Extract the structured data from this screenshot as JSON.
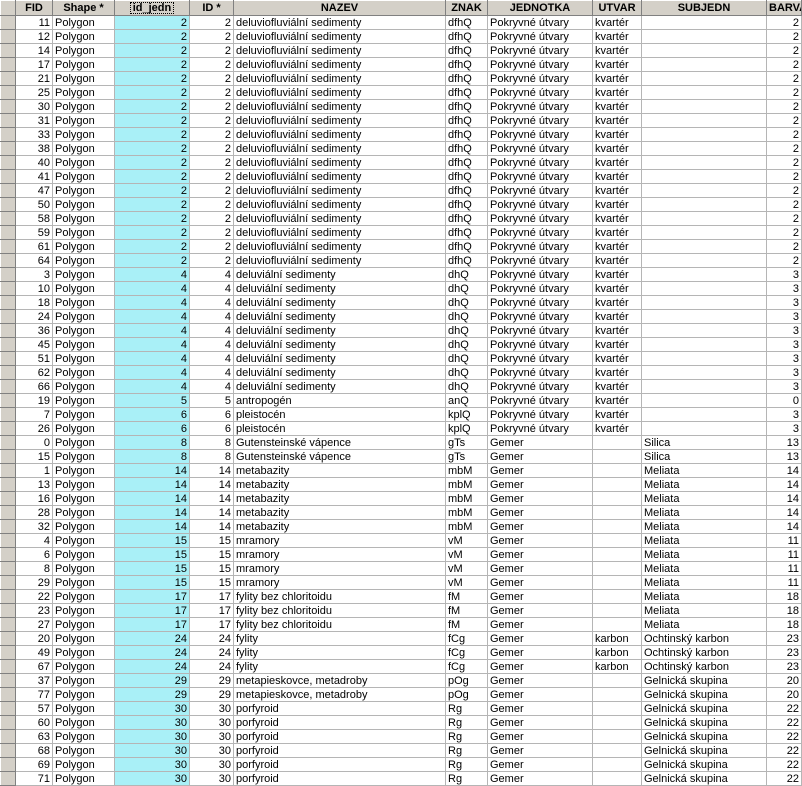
{
  "columns": [
    "",
    "FID",
    "Shape *",
    "id_jedn",
    "ID *",
    "NAZEV",
    "ZNAK",
    "JEDNOTKA",
    "UTVAR",
    "SUBJEDN",
    "BARVA"
  ],
  "rows": [
    [
      "11",
      "Polygon",
      "2",
      "2",
      "deluviofluviální sedimenty",
      "dfhQ",
      "Pokryvné útvary",
      "kvartér",
      "",
      "2"
    ],
    [
      "12",
      "Polygon",
      "2",
      "2",
      "deluviofluviální sedimenty",
      "dfhQ",
      "Pokryvné útvary",
      "kvartér",
      "",
      "2"
    ],
    [
      "14",
      "Polygon",
      "2",
      "2",
      "deluviofluviální sedimenty",
      "dfhQ",
      "Pokryvné útvary",
      "kvartér",
      "",
      "2"
    ],
    [
      "17",
      "Polygon",
      "2",
      "2",
      "deluviofluviální sedimenty",
      "dfhQ",
      "Pokryvné útvary",
      "kvartér",
      "",
      "2"
    ],
    [
      "21",
      "Polygon",
      "2",
      "2",
      "deluviofluviální sedimenty",
      "dfhQ",
      "Pokryvné útvary",
      "kvartér",
      "",
      "2"
    ],
    [
      "25",
      "Polygon",
      "2",
      "2",
      "deluviofluviální sedimenty",
      "dfhQ",
      "Pokryvné útvary",
      "kvartér",
      "",
      "2"
    ],
    [
      "30",
      "Polygon",
      "2",
      "2",
      "deluviofluviální sedimenty",
      "dfhQ",
      "Pokryvné útvary",
      "kvartér",
      "",
      "2"
    ],
    [
      "31",
      "Polygon",
      "2",
      "2",
      "deluviofluviální sedimenty",
      "dfhQ",
      "Pokryvné útvary",
      "kvartér",
      "",
      "2"
    ],
    [
      "33",
      "Polygon",
      "2",
      "2",
      "deluviofluviální sedimenty",
      "dfhQ",
      "Pokryvné útvary",
      "kvartér",
      "",
      "2"
    ],
    [
      "38",
      "Polygon",
      "2",
      "2",
      "deluviofluviální sedimenty",
      "dfhQ",
      "Pokryvné útvary",
      "kvartér",
      "",
      "2"
    ],
    [
      "40",
      "Polygon",
      "2",
      "2",
      "deluviofluviální sedimenty",
      "dfhQ",
      "Pokryvné útvary",
      "kvartér",
      "",
      "2"
    ],
    [
      "41",
      "Polygon",
      "2",
      "2",
      "deluviofluviální sedimenty",
      "dfhQ",
      "Pokryvné útvary",
      "kvartér",
      "",
      "2"
    ],
    [
      "47",
      "Polygon",
      "2",
      "2",
      "deluviofluviální sedimenty",
      "dfhQ",
      "Pokryvné útvary",
      "kvartér",
      "",
      "2"
    ],
    [
      "50",
      "Polygon",
      "2",
      "2",
      "deluviofluviální sedimenty",
      "dfhQ",
      "Pokryvné útvary",
      "kvartér",
      "",
      "2"
    ],
    [
      "58",
      "Polygon",
      "2",
      "2",
      "deluviofluviální sedimenty",
      "dfhQ",
      "Pokryvné útvary",
      "kvartér",
      "",
      "2"
    ],
    [
      "59",
      "Polygon",
      "2",
      "2",
      "deluviofluviální sedimenty",
      "dfhQ",
      "Pokryvné útvary",
      "kvartér",
      "",
      "2"
    ],
    [
      "61",
      "Polygon",
      "2",
      "2",
      "deluviofluviální sedimenty",
      "dfhQ",
      "Pokryvné útvary",
      "kvartér",
      "",
      "2"
    ],
    [
      "64",
      "Polygon",
      "2",
      "2",
      "deluviofluviální sedimenty",
      "dfhQ",
      "Pokryvné útvary",
      "kvartér",
      "",
      "2"
    ],
    [
      "3",
      "Polygon",
      "4",
      "4",
      "deluviální sedimenty",
      "dhQ",
      "Pokryvné útvary",
      "kvartér",
      "",
      "3"
    ],
    [
      "10",
      "Polygon",
      "4",
      "4",
      "deluviální sedimenty",
      "dhQ",
      "Pokryvné útvary",
      "kvartér",
      "",
      "3"
    ],
    [
      "18",
      "Polygon",
      "4",
      "4",
      "deluviální sedimenty",
      "dhQ",
      "Pokryvné útvary",
      "kvartér",
      "",
      "3"
    ],
    [
      "24",
      "Polygon",
      "4",
      "4",
      "deluviální sedimenty",
      "dhQ",
      "Pokryvné útvary",
      "kvartér",
      "",
      "3"
    ],
    [
      "36",
      "Polygon",
      "4",
      "4",
      "deluviální sedimenty",
      "dhQ",
      "Pokryvné útvary",
      "kvartér",
      "",
      "3"
    ],
    [
      "45",
      "Polygon",
      "4",
      "4",
      "deluviální sedimenty",
      "dhQ",
      "Pokryvné útvary",
      "kvartér",
      "",
      "3"
    ],
    [
      "51",
      "Polygon",
      "4",
      "4",
      "deluviální sedimenty",
      "dhQ",
      "Pokryvné útvary",
      "kvartér",
      "",
      "3"
    ],
    [
      "62",
      "Polygon",
      "4",
      "4",
      "deluviální sedimenty",
      "dhQ",
      "Pokryvné útvary",
      "kvartér",
      "",
      "3"
    ],
    [
      "66",
      "Polygon",
      "4",
      "4",
      "deluviální sedimenty",
      "dhQ",
      "Pokryvné útvary",
      "kvartér",
      "",
      "3"
    ],
    [
      "19",
      "Polygon",
      "5",
      "5",
      "antropogén",
      "anQ",
      "Pokryvné útvary",
      "kvartér",
      "",
      "0"
    ],
    [
      "7",
      "Polygon",
      "6",
      "6",
      "pleistocén",
      "kplQ",
      "Pokryvné útvary",
      "kvartér",
      "",
      "3"
    ],
    [
      "26",
      "Polygon",
      "6",
      "6",
      "pleistocén",
      "kplQ",
      "Pokryvné útvary",
      "kvartér",
      "",
      "3"
    ],
    [
      "0",
      "Polygon",
      "8",
      "8",
      "Gutensteinské vápence",
      "gTs",
      "Gemer",
      "",
      "Silica",
      "13"
    ],
    [
      "15",
      "Polygon",
      "8",
      "8",
      "Gutensteinské vápence",
      "gTs",
      "Gemer",
      "",
      "Silica",
      "13"
    ],
    [
      "1",
      "Polygon",
      "14",
      "14",
      "metabazity",
      "mbM",
      "Gemer",
      "",
      "Meliata",
      "14"
    ],
    [
      "13",
      "Polygon",
      "14",
      "14",
      "metabazity",
      "mbM",
      "Gemer",
      "",
      "Meliata",
      "14"
    ],
    [
      "16",
      "Polygon",
      "14",
      "14",
      "metabazity",
      "mbM",
      "Gemer",
      "",
      "Meliata",
      "14"
    ],
    [
      "28",
      "Polygon",
      "14",
      "14",
      "metabazity",
      "mbM",
      "Gemer",
      "",
      "Meliata",
      "14"
    ],
    [
      "32",
      "Polygon",
      "14",
      "14",
      "metabazity",
      "mbM",
      "Gemer",
      "",
      "Meliata",
      "14"
    ],
    [
      "4",
      "Polygon",
      "15",
      "15",
      "mramory",
      "vM",
      "Gemer",
      "",
      "Meliata",
      "11"
    ],
    [
      "6",
      "Polygon",
      "15",
      "15",
      "mramory",
      "vM",
      "Gemer",
      "",
      "Meliata",
      "11"
    ],
    [
      "8",
      "Polygon",
      "15",
      "15",
      "mramory",
      "vM",
      "Gemer",
      "",
      "Meliata",
      "11"
    ],
    [
      "29",
      "Polygon",
      "15",
      "15",
      "mramory",
      "vM",
      "Gemer",
      "",
      "Meliata",
      "11"
    ],
    [
      "22",
      "Polygon",
      "17",
      "17",
      "fylity bez chloritoidu",
      "fM",
      "Gemer",
      "",
      "Meliata",
      "18"
    ],
    [
      "23",
      "Polygon",
      "17",
      "17",
      "fylity bez chloritoidu",
      "fM",
      "Gemer",
      "",
      "Meliata",
      "18"
    ],
    [
      "27",
      "Polygon",
      "17",
      "17",
      "fylity bez chloritoidu",
      "fM",
      "Gemer",
      "",
      "Meliata",
      "18"
    ],
    [
      "20",
      "Polygon",
      "24",
      "24",
      "fylity",
      "fCg",
      "Gemer",
      "karbon",
      "Ochtinský karbon",
      "23"
    ],
    [
      "49",
      "Polygon",
      "24",
      "24",
      "fylity",
      "fCg",
      "Gemer",
      "karbon",
      "Ochtinský karbon",
      "23"
    ],
    [
      "67",
      "Polygon",
      "24",
      "24",
      "fylity",
      "fCg",
      "Gemer",
      "karbon",
      "Ochtinský karbon",
      "23"
    ],
    [
      "37",
      "Polygon",
      "29",
      "29",
      "metapieskovce, metadroby",
      "pOg",
      "Gemer",
      "",
      "Gelnická skupina",
      "20"
    ],
    [
      "77",
      "Polygon",
      "29",
      "29",
      "metapieskovce, metadroby",
      "pOg",
      "Gemer",
      "",
      "Gelnická skupina",
      "20"
    ],
    [
      "57",
      "Polygon",
      "30",
      "30",
      "porfyroid",
      "Rg",
      "Gemer",
      "",
      "Gelnická skupina",
      "22"
    ],
    [
      "60",
      "Polygon",
      "30",
      "30",
      "porfyroid",
      "Rg",
      "Gemer",
      "",
      "Gelnická skupina",
      "22"
    ],
    [
      "63",
      "Polygon",
      "30",
      "30",
      "porfyroid",
      "Rg",
      "Gemer",
      "",
      "Gelnická skupina",
      "22"
    ],
    [
      "68",
      "Polygon",
      "30",
      "30",
      "porfyroid",
      "Rg",
      "Gemer",
      "",
      "Gelnická skupina",
      "22"
    ],
    [
      "69",
      "Polygon",
      "30",
      "30",
      "porfyroid",
      "Rg",
      "Gemer",
      "",
      "Gelnická skupina",
      "22"
    ],
    [
      "71",
      "Polygon",
      "30",
      "30",
      "porfyroid",
      "Rg",
      "Gemer",
      "",
      "Gelnická skupina",
      "22"
    ]
  ],
  "colors": {
    "highlight_column": "#a9f0f7",
    "header_bg": "#d4d0c8"
  }
}
